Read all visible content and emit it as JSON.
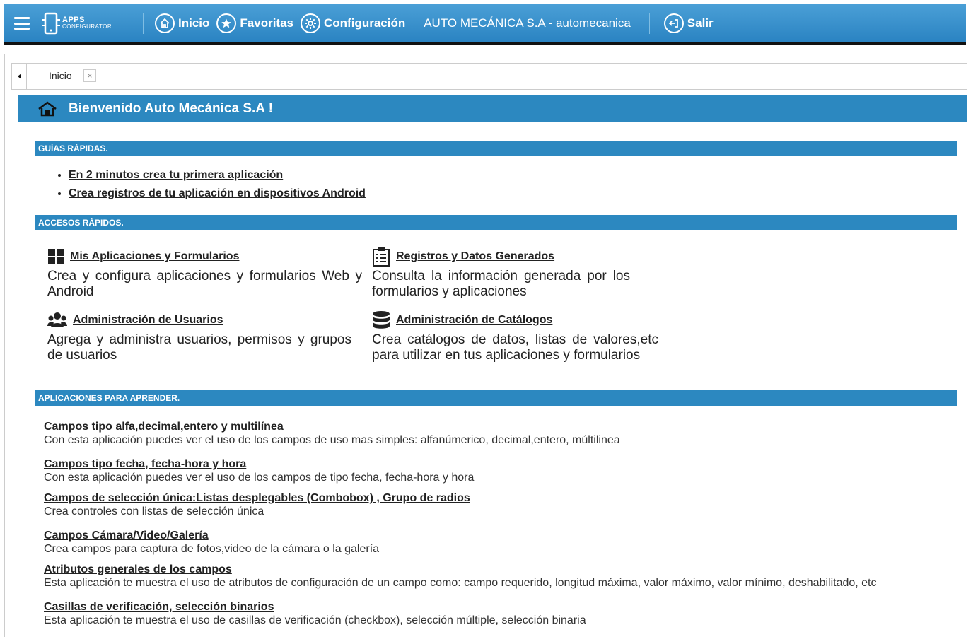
{
  "nav": {
    "logo_line1": "APPS",
    "logo_line2": "CONFIGURATOR",
    "items": [
      {
        "label": "Inicio",
        "icon": "home-icon"
      },
      {
        "label": "Favoritas",
        "icon": "star-icon"
      },
      {
        "label": "Configuración",
        "icon": "gear-icon"
      }
    ],
    "company": "AUTO MECÁNICA S.A - automecanica",
    "logout": "Salir"
  },
  "tabs": [
    {
      "label": "Inicio",
      "close": "×"
    }
  ],
  "welcome": "Bienvenido Auto Mecánica S.A !",
  "sections": {
    "guides": "GUÍAS RÁPIDAS.",
    "access": "ACCESOS RÁPIDOS.",
    "apps": "APLICACIONES PARA APRENDER."
  },
  "guides": [
    "En 2 minutos crea tu primera aplicación",
    "Crea registros de tu aplicación en dispositivos Android"
  ],
  "quick_access": [
    {
      "title": "Mis Aplicaciones y Formularios",
      "desc": "Crea y configura aplicaciones y formularios Web y Android",
      "icon": "grid-icon"
    },
    {
      "title": "Registros y Datos Generados",
      "desc": "Consulta la información generada por los formularios y aplicaciones",
      "icon": "clipboard-icon"
    },
    {
      "title": "Administración de Usuarios",
      "desc": "Agrega y administra usuarios, permisos y grupos de usuarios",
      "icon": "users-icon"
    },
    {
      "title": "Administración de Catálogos",
      "desc": "Crea catálogos de datos, listas de valores,etc para utilizar en tus aplicaciones y formularios",
      "icon": "database-icon"
    }
  ],
  "apps": [
    {
      "title": "Campos tipo alfa,decimal,entero y multilínea",
      "desc": "Con esta aplicación puedes ver el uso de los campos de uso mas simples: alfanúmerico, decimal,entero, múltilinea"
    },
    {
      "title": "Campos tipo fecha, fecha-hora y hora",
      "desc": "Con esta aplicación puedes ver el uso de los campos de tipo fecha, fecha-hora y hora"
    },
    {
      "title": "Campos de selección única:Listas desplegables (Combobox) , Grupo de radios",
      "desc": "Crea controles con listas de selección única"
    },
    {
      "title": "Campos Cámara/Video/Galería",
      "desc": "Crea campos para captura de fotos,video de la cámara o la galería"
    },
    {
      "title": "Atributos generales de los campos",
      "desc": "Esta aplicación te muestra el uso de atributos de configuración de un campo como: campo requerido, longitud máxima, valor máximo, valor mínimo, deshabilitado, etc"
    },
    {
      "title": "Casillas de verificación, selección binarios",
      "desc": "Esta aplicación te muestra el uso de casillas de verificación (checkbox), selección múltiple, selección binaria"
    }
  ]
}
